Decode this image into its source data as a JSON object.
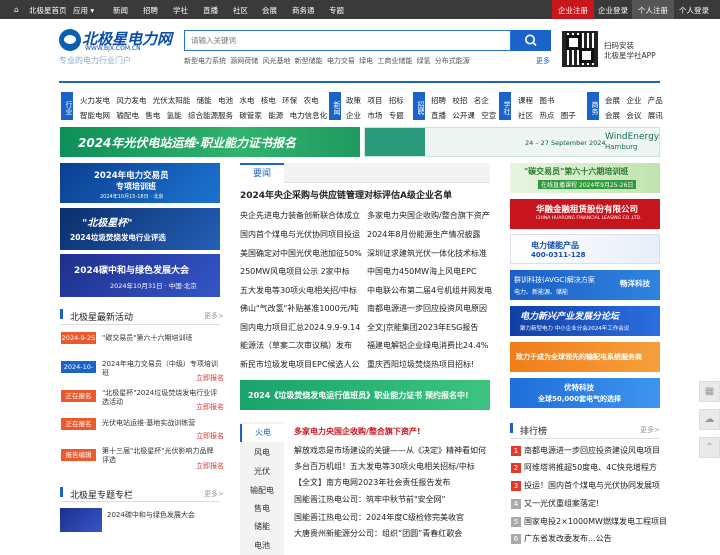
{
  "topbar": {
    "items": [
      "北极星首页",
      "应用 ▾",
      "新闻",
      "招聘",
      "学社",
      "直播",
      "社区",
      "会展",
      "商务通",
      "专题"
    ],
    "enterprise_register": "企业注册",
    "enterprise_login": "企业登录",
    "personal_register": "个人注册",
    "personal_login": "个人登录"
  },
  "header": {
    "logo_text": "北极星电力网",
    "logo_url": "WWW.BJX.COM.CN",
    "slogan": "专业的电力行业门户",
    "search_placeholder": "请输入关键词",
    "hot_words": "新型电力系统  源网荷储  风光基地  新型储能  电力交易  绿电  工商业储能  绿氢  分布式能源",
    "more": "更多",
    "app_line1": "扫码安装",
    "app_line2": "北极星学社APP"
  },
  "categories": {
    "industry_label": "行业",
    "industry_row1": "火力发电 风力发电 光伏太阳能 储能 电池 水电 核电 环保 农电",
    "industry_row2": "智能电网 输配电 售电 氢能 综合能源服务 碳管家 能源 电力信息化",
    "news_label": "新闻",
    "news_row1": "政策 项目 招标",
    "news_row2": "企业 市场 专题",
    "jobs_label": "招聘",
    "jobs_row1": "招聘 校招 名企",
    "jobs_row2": "直播 公开课 空宣",
    "school_label": "学社",
    "school_row1": "课程 图书",
    "school_row2": "社区 热点 圈子",
    "biz_label": "商务",
    "biz_row1": "会展 企业 产品",
    "biz_row2": "会展 会议 展讯"
  },
  "banners": {
    "pv_ops": "2024年光伏电站运维·职业能力证书报名",
    "windenergy_title": "WindEnergy",
    "windenergy_city": "Hamburg",
    "windenergy_date": "24 – 27 September 2024",
    "left1_title": "2024年电力交易员",
    "left1_sub": "专项培训班",
    "left1_date": "2024年10月15-18日 · 北京",
    "left2_title": "\"北极星杯\"",
    "left2_sub": "2024垃圾焚烧发电行业评选",
    "left3_title": "2024碳中和与绿色发展大会",
    "left3_date": "2024年10月31日 · 中国·北京",
    "mid_banner": "2024《垃圾焚烧发电运行值班员》职业能力证书 预约报名中!",
    "r1": "\"碳交易员\"第六十六期培训班",
    "r1_sub": "在线直播课程 2024年9月25-26日",
    "r2": "华融金融租赁股份有限公司",
    "r2_sub": "CHINA HUARONG FINANCIAL LEASING CO.,LTD.",
    "r3": "电力储能产品",
    "r3_phone": "400-0311-128",
    "r4": "群训科技(AVGC)解决方案",
    "r4_sub": "电力、新能源、储能",
    "r4_brand": "畅洋科技",
    "r5": "电力新兴产业发展分论坛",
    "r5_sub": "聚力新型电力 中小企业分会2024年工作会议",
    "r6": "致力于成为全球领先的输配电系统服务商",
    "r7": "优特科技",
    "r7_sub": "全球50,000套电气的选择"
  },
  "yaowen": {
    "tab": "要闻",
    "headline": "2024年央企采购与供应链管理对标评估A级企业名单",
    "left": [
      "央企先进电力装备创新联合体成立",
      "国内首个煤电与光伏协同项目投运",
      "美国确定对中国光伏电池加征50%",
      "250MW风电项目公示 2家中标",
      "五大发电等30项火电相关招/中标",
      "佛山\"气改氢\"补贴基准1000元/吨",
      "国内电力项目汇总2024.9.9-9.14",
      "能源法（草案二次审议稿）发布",
      "新民市垃圾发电项目EPC候选人公"
    ],
    "right": [
      "多家电力央国企收购/整合旗下资产",
      "2024年8月份能源生产情况披露",
      "深圳证求建筑光伏一体化技术标准",
      "中国电力450MW海上风电EPC",
      "中电联公布第二届4号机组并网发电",
      "南都电源进一步回应投资风电原因",
      "全文|京能集团2023年ESG报告",
      "福建电解铝企业绿电消费比24.4%",
      "重庆西阳垃圾焚烧热项目招标!"
    ]
  },
  "activities": {
    "title": "北极星最新活动",
    "more": "更多>",
    "items": [
      {
        "badge": "2024-9-25",
        "text": "\"碳交易员\"第六十六期培训班",
        "link": ""
      },
      {
        "badge": "2024-10-15",
        "text": "2024年电力交易员（中级）专项培训班",
        "link": "立即报名"
      },
      {
        "badge": "正在报名",
        "text": "\"北极星杯\"2024垃圾焚烧发电行业评选活动",
        "link": "立即报名"
      },
      {
        "badge": "正在报名",
        "text": "光伏电站运维·基地实战训练营",
        "link": "立即报名"
      },
      {
        "badge": "报告编辑",
        "text": "第十三届\"北极星杯\"光伏影响力品牌评选",
        "link": "立即报名"
      }
    ]
  },
  "columns": {
    "title": "北极星专题专栏",
    "more": "更多>",
    "item1": "2024碳中和与绿色发展大会"
  },
  "energy_tabs": [
    "火电",
    "风电",
    "光伏",
    "输配电",
    "售电",
    "储能",
    "电池"
  ],
  "energy_news": {
    "headline": "多家电力央国企收购/整合旗下资产!",
    "items": [
      "解放戏恋是市场建设的关键——从《决定》精神看如何",
      "多台百万机组！五大发电等30项火电相关招标/中标",
      "【全文】南方电网2023年社会责任报告发布",
      "国能晋江热电公司：筑牢中秋节前\"安全网\"",
      "国能晋江热电公司：2024年度C级检修完美收官",
      "大唐贵州新能源分公司：组织“团圆”青春红歌会"
    ]
  },
  "ranking": {
    "title": "排行榜",
    "more": "更多>",
    "items": [
      "南都电源进一步回应投资建设风电项目",
      "阿维塔将推超50度电、4C快充增程方",
      "投运！国内首个煤电与光伏协同发展项",
      "又一光伏重组案落定!",
      "国家电投2×1000MW燃煤发电工程项目",
      "广东省发改委发布...公告"
    ]
  }
}
